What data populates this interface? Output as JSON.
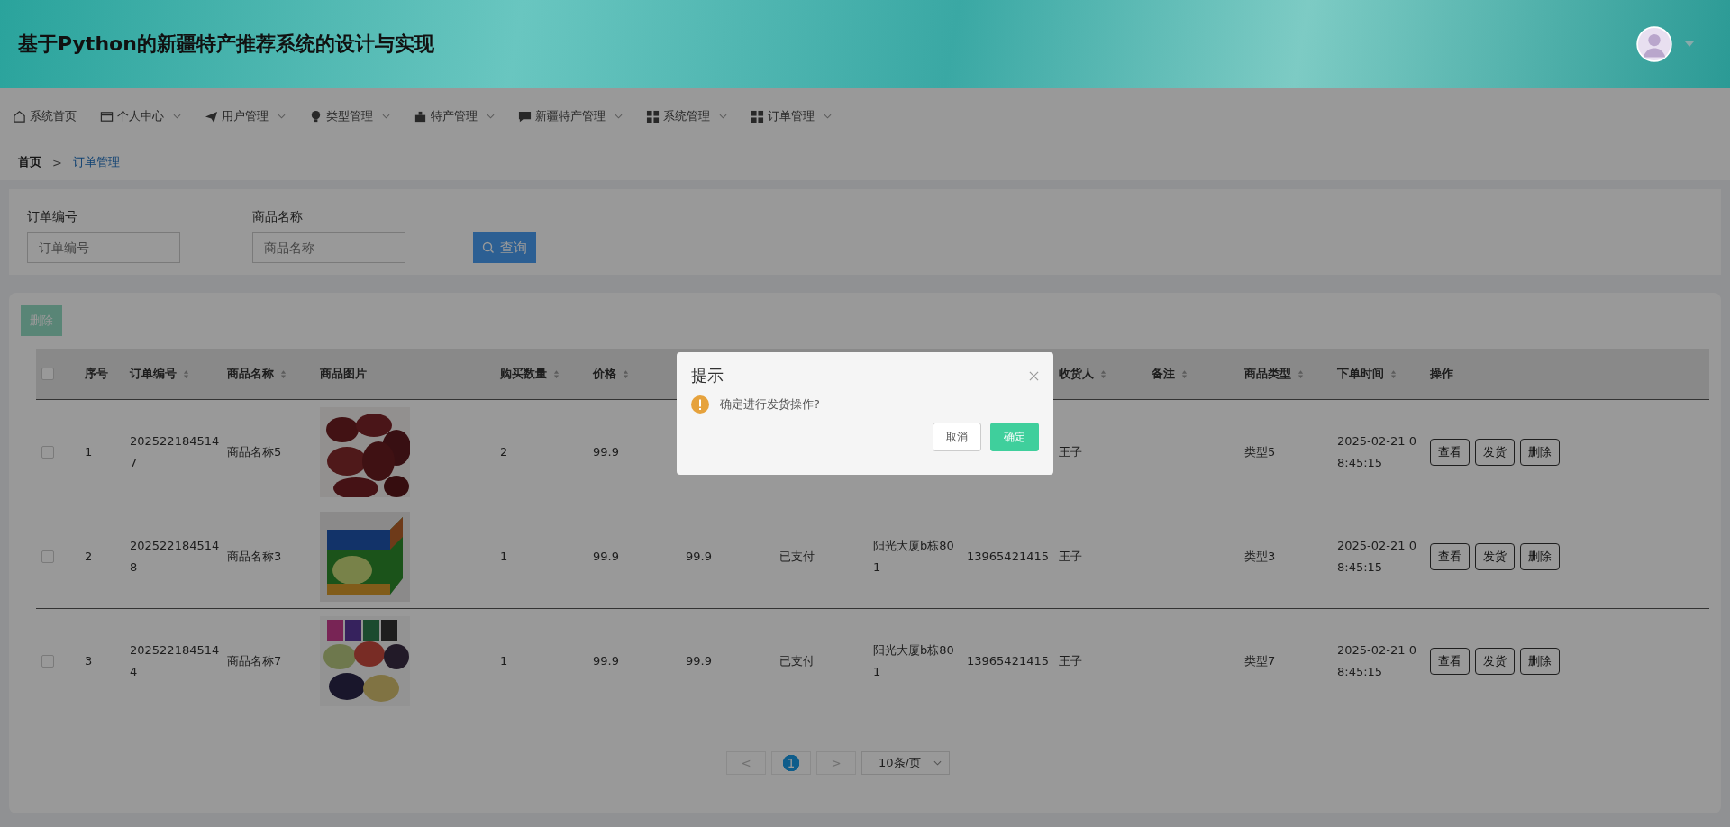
{
  "header": {
    "title": "基于Python的新疆特产推荐系统的设计与实现"
  },
  "nav": [
    {
      "label": "系统首页",
      "has_menu": false
    },
    {
      "label": "个人中心",
      "has_menu": true
    },
    {
      "label": "用户管理",
      "has_menu": true
    },
    {
      "label": "类型管理",
      "has_menu": true
    },
    {
      "label": "特产管理",
      "has_menu": true
    },
    {
      "label": "新疆特产管理",
      "has_menu": true
    },
    {
      "label": "系统管理",
      "has_menu": true
    },
    {
      "label": "订单管理",
      "has_menu": true
    }
  ],
  "breadcrumb": [
    {
      "label": "首页",
      "current": false
    },
    {
      "label": "订单管理",
      "current": true
    }
  ],
  "breadcrumb_separator": ">",
  "search": {
    "fields": [
      {
        "label": "订单编号",
        "placeholder": "订单编号"
      },
      {
        "label": "商品名称",
        "placeholder": "商品名称"
      }
    ],
    "button": "查询"
  },
  "delete_button": {
    "label": "删除",
    "disabled": true
  },
  "table": {
    "all_checked": false,
    "columns": [
      {
        "label": "序号",
        "sortable": false
      },
      {
        "label": "订单编号",
        "sortable": true
      },
      {
        "label": "商品名称",
        "sortable": true
      },
      {
        "label": "商品图片",
        "sortable": false
      },
      {
        "label": "购买数量",
        "sortable": true
      },
      {
        "label": "价格",
        "sortable": true
      },
      null,
      null,
      null,
      null,
      {
        "label": "收货人",
        "sortable": true
      },
      {
        "label": "备注",
        "sortable": true
      },
      {
        "label": "商品类型",
        "sortable": true
      },
      {
        "label": "下单时间",
        "sortable": true
      },
      {
        "label": "操作",
        "sortable": false
      }
    ],
    "rows": [
      {
        "checked": false,
        "cells": [
          "1",
          "2025221845147",
          "商品名称5",
          {
            "kind": "picture"
          },
          "2",
          "99.9",
          null,
          null,
          null,
          null,
          "王子",
          null,
          "类型5",
          "2025-02-21 08:45:15"
        ],
        "actions": [
          "查看",
          "发货",
          "删除"
        ]
      },
      {
        "checked": false,
        "cells": [
          "2",
          "2025221845148",
          "商品名称3",
          {
            "kind": "picture"
          },
          "1",
          "99.9",
          "99.9",
          "已支付",
          "阳光大厦b栋801",
          "13965421415",
          "王子",
          null,
          "类型3",
          "2025-02-21 08:45:15"
        ],
        "actions": [
          "查看",
          "发货",
          "删除"
        ]
      },
      {
        "checked": false,
        "cells": [
          "3",
          "2025221845144",
          "商品名称7",
          {
            "kind": "picture"
          },
          "1",
          "99.9",
          "99.9",
          "已支付",
          "阳光大厦b栋801",
          "13965421415",
          "王子",
          null,
          "类型7",
          "2025-02-21 08:45:15"
        ],
        "actions": [
          "查看",
          "发货",
          "删除"
        ]
      }
    ]
  },
  "pagination": {
    "prev": "<",
    "pages": [
      {
        "label": "1",
        "selected": true
      }
    ],
    "next": ">",
    "page_size": "10条/页"
  },
  "dialog": {
    "title": "提示",
    "message": "确定进行发货操作?",
    "buttons": [
      {
        "label": "取消",
        "kind": "plain"
      },
      {
        "label": "确定",
        "kind": "primary"
      }
    ]
  }
}
